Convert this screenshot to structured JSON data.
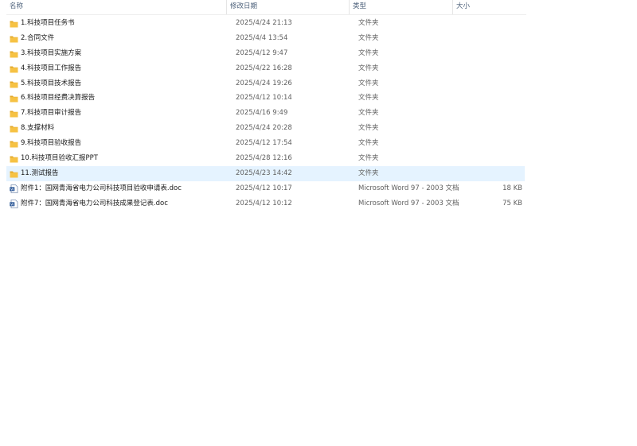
{
  "columns": {
    "name": "名称",
    "date": "修改日期",
    "type": "类型",
    "size": "大小",
    "sort_indicator": "^"
  },
  "files": [
    {
      "name": "1.科技项目任务书",
      "date": "2025/4/24 21:13",
      "type": "文件夹",
      "size": "",
      "icon": "folder-icon"
    },
    {
      "name": "2.合同文件",
      "date": "2025/4/4 13:54",
      "type": "文件夹",
      "size": "",
      "icon": "folder-icon"
    },
    {
      "name": "3.科技项目实施方案",
      "date": "2025/4/12 9:47",
      "type": "文件夹",
      "size": "",
      "icon": "folder-icon"
    },
    {
      "name": "4.科技项目工作报告",
      "date": "2025/4/22 16:28",
      "type": "文件夹",
      "size": "",
      "icon": "folder-icon"
    },
    {
      "name": "5.科技项目技术报告",
      "date": "2025/4/24 19:26",
      "type": "文件夹",
      "size": "",
      "icon": "folder-icon"
    },
    {
      "name": "6.科技项目经费决算报告",
      "date": "2025/4/12 10:14",
      "type": "文件夹",
      "size": "",
      "icon": "folder-icon"
    },
    {
      "name": "7.科技项目审计报告",
      "date": "2025/4/16 9:49",
      "type": "文件夹",
      "size": "",
      "icon": "folder-icon"
    },
    {
      "name": "8.支撑材料",
      "date": "2025/4/24 20:28",
      "type": "文件夹",
      "size": "",
      "icon": "folder-icon"
    },
    {
      "name": "9.科技项目验收报告",
      "date": "2025/4/12 17:54",
      "type": "文件夹",
      "size": "",
      "icon": "folder-icon"
    },
    {
      "name": "10.科技项目验收汇报PPT",
      "date": "2025/4/28 12:16",
      "type": "文件夹",
      "size": "",
      "icon": "folder-icon"
    },
    {
      "name": "11.测试报告",
      "date": "2025/4/23 14:42",
      "type": "文件夹",
      "size": "",
      "icon": "folder-icon",
      "selected": true
    },
    {
      "name": "附件1：国网青海省电力公司科技项目验收申请表.doc",
      "date": "2025/4/12 10:17",
      "type": "Microsoft Word 97 - 2003 文档",
      "size": "18 KB",
      "icon": "word-doc-icon"
    },
    {
      "name": "附件7：国网青海省电力公司科技成果登记表.doc",
      "date": "2025/4/12 10:12",
      "type": "Microsoft Word 97 - 2003 文档",
      "size": "75 KB",
      "icon": "word-doc-icon"
    }
  ],
  "colors": {
    "folder": "#f6c244",
    "folder_dark": "#e2a727",
    "selected_row": "#e5f3ff",
    "doc_blue": "#2b5797"
  }
}
